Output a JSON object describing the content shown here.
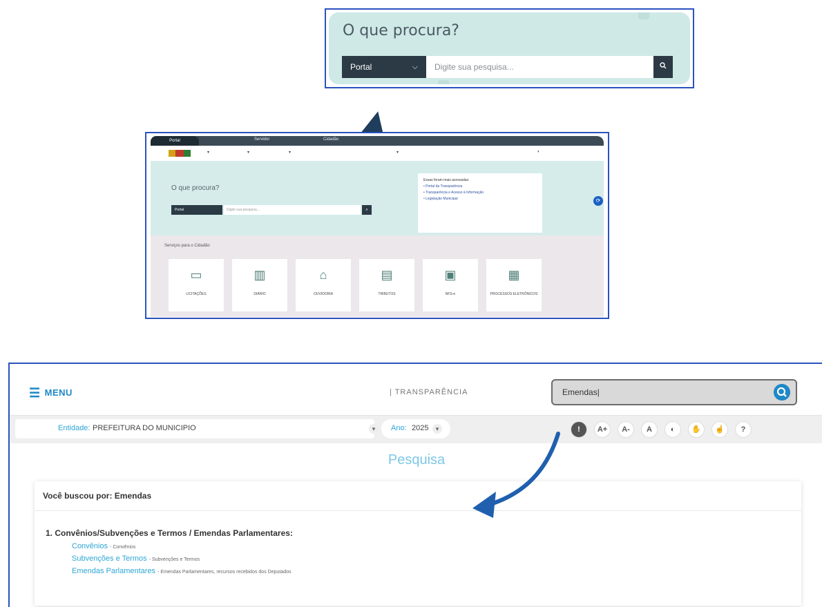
{
  "zoom_panel": {
    "title": "O que procura?",
    "portal_select": "Portal",
    "search_placeholder": "Digite sua pesquisa..."
  },
  "site_panel": {
    "top_tabs": [
      "Portal",
      "Servidor",
      "Cidadão"
    ],
    "hero_title": "O que procura?",
    "portal_select": "Portal",
    "search_placeholder": "Digite sua pesquisa...",
    "quick_links_title": "Essas foram mais acessadas:",
    "quick_links": [
      "Portal da Transparência",
      "Transparência e Acesso à Informação",
      "Legislação Municipal"
    ],
    "services_title": "Serviços para o Cidadão",
    "services": [
      "LICITAÇÕES",
      "DIÁRIO",
      "OUVIDORIA",
      "TRIBUTOS",
      "NFS-e",
      "PROCESSOS ELETRÔNICOS"
    ]
  },
  "result_page": {
    "menu_label": "MENU",
    "brand": "| TRANSPARÊNCIA",
    "search_value": "Emendas|",
    "entity_label": "Entidade:",
    "entity_value": "PREFEITURA DO MUNICIPIO",
    "year_label": "Ano:",
    "year_value": "2025",
    "accessibility_buttons": [
      "A+",
      "A-",
      "A",
      "?"
    ],
    "page_title": "Pesquisa",
    "query_text": "Você buscou por: Emendas",
    "category": "1. Convênios/Subvenções e Termos / Emendas Parlamentares:",
    "items": [
      {
        "link": "Convênios",
        "desc": "- Convênios"
      },
      {
        "link": "Subvenções e Termos",
        "desc": "- Subvenções e Termos"
      },
      {
        "link": "Emendas Parlamentares",
        "desc": "- Emendas Parlamentares, recursos recebidos dos Deputados"
      }
    ]
  },
  "colors": {
    "highlight_border": "#2a52be",
    "teal_bg": "#cfe9e6",
    "dark_navy": "#2b3a45",
    "accent_blue": "#1e88c8",
    "link_blue": "#2ea6d6"
  }
}
